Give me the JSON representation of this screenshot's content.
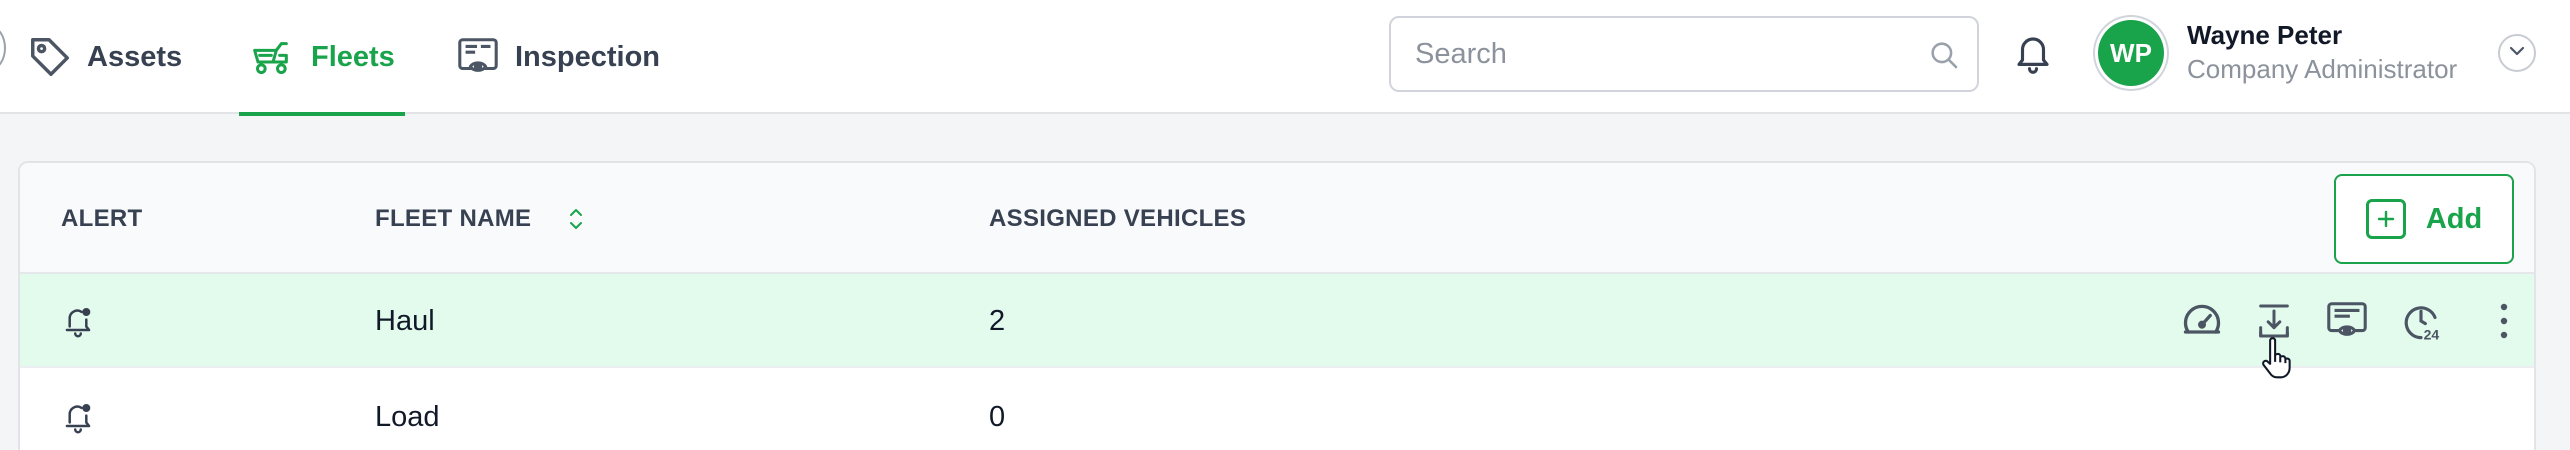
{
  "nav": {
    "tabs": [
      {
        "label": "Assets",
        "icon": "tag-icon"
      },
      {
        "label": "Fleets",
        "icon": "fleet-icon",
        "active": true
      },
      {
        "label": "Inspection",
        "icon": "inspection-icon"
      }
    ]
  },
  "search": {
    "placeholder": "Search",
    "value": ""
  },
  "user": {
    "initials": "WP",
    "name": "Wayne Peter",
    "role": "Company Administrator"
  },
  "table": {
    "columns": [
      "ALERT",
      "FLEET NAME",
      "ASSIGNED VEHICLES"
    ],
    "add_label": "Add",
    "rows": [
      {
        "fleet_name": "Haul",
        "assigned_vehicles": "2",
        "selected": true
      },
      {
        "fleet_name": "Load",
        "assigned_vehicles": "0",
        "selected": false
      }
    ],
    "row_actions": [
      "speedometer-icon",
      "download-icon",
      "inspection-icon",
      "history-24-icon",
      "more-vertical-icon"
    ]
  },
  "colors": {
    "accent": "#19a34a",
    "selected_row": "#e3fbec",
    "icon": "#4b5563"
  }
}
